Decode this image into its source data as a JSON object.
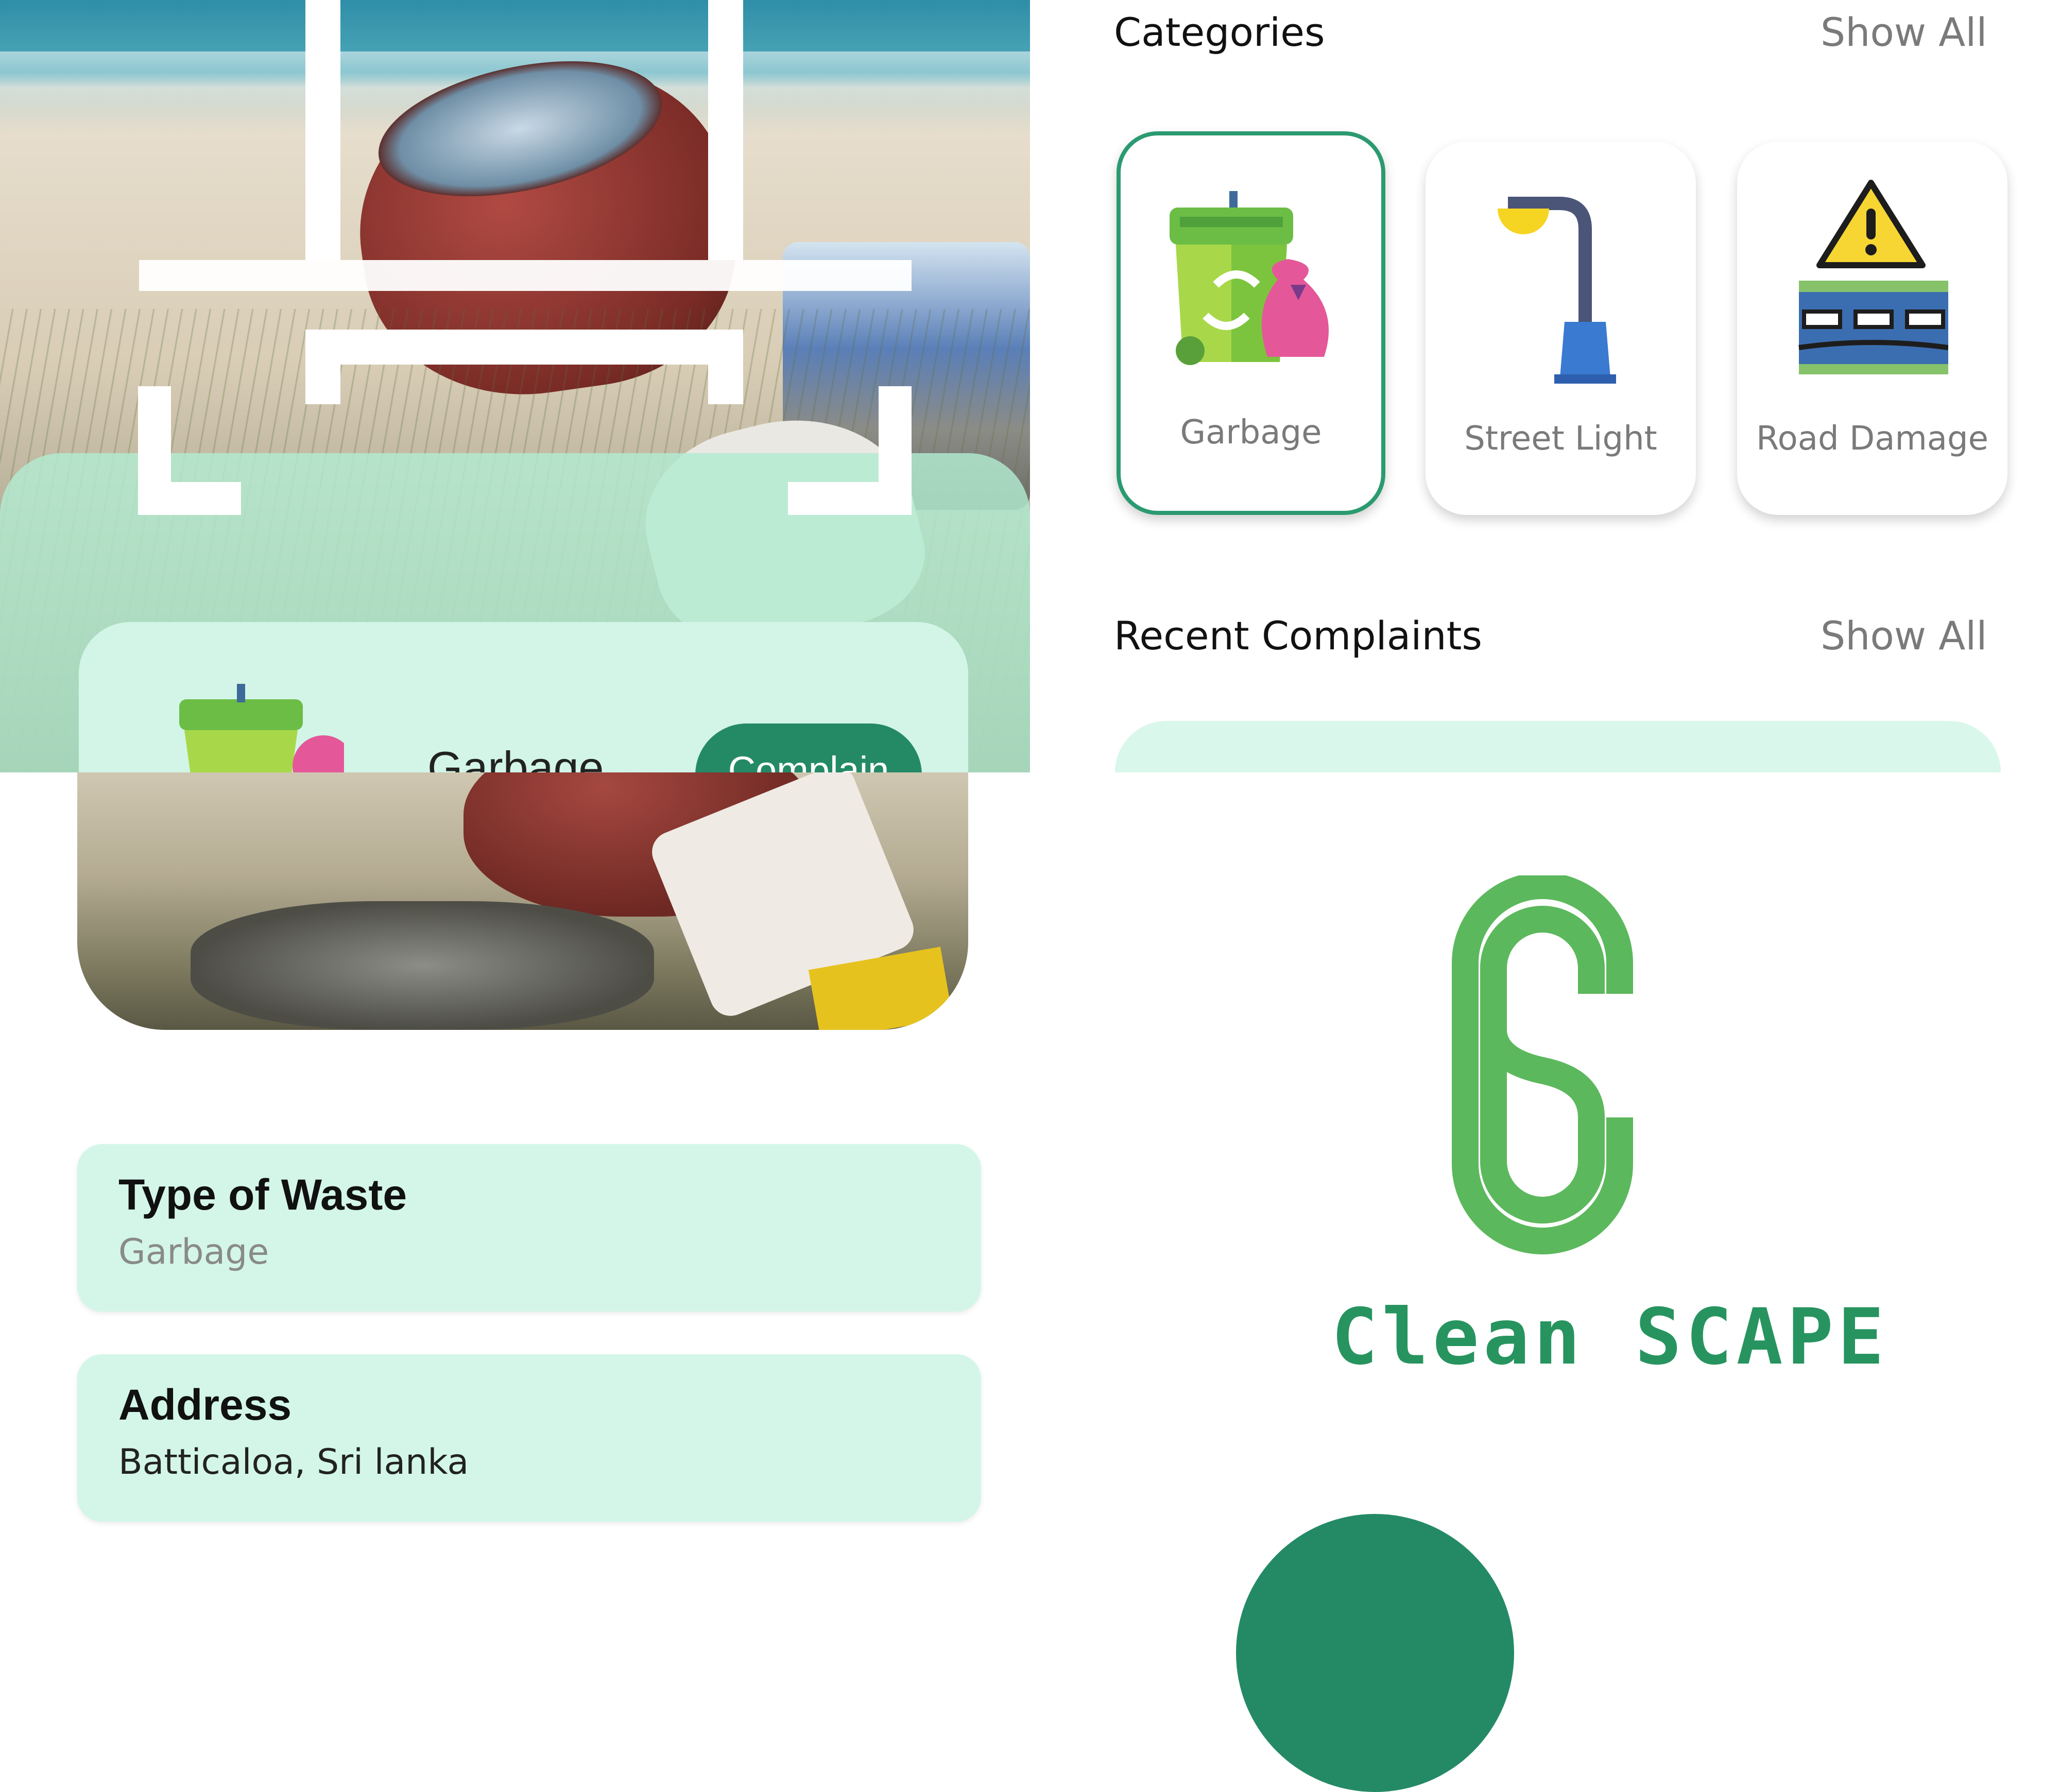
{
  "scan_screen": {
    "result": {
      "category_label": "Garbage",
      "complain_label": "Complain"
    }
  },
  "details_screen": {
    "fields": [
      {
        "label": "Type of Waste",
        "value": "Garbage"
      },
      {
        "label": "Address",
        "value": "Batticaloa, Sri lanka"
      }
    ]
  },
  "home_screen": {
    "categories_title": "Categories",
    "categories_show_all": "Show All",
    "categories": [
      {
        "label": "Garbage",
        "icon": "garbage-bin-icon",
        "selected": true
      },
      {
        "label": "Street Light",
        "icon": "street-light-icon",
        "selected": false
      },
      {
        "label": "Road Damage",
        "icon": "road-damage-icon",
        "selected": false
      }
    ],
    "recent_title": "Recent Complaints",
    "recent_show_all": "Show All"
  },
  "splash_screen": {
    "brand_name": "Clean SCAPE",
    "logo_icon": "cleanscape-logo-icon"
  },
  "colors": {
    "primary": "#248a66",
    "mint": "#d3f6e8",
    "logo_green": "#5cb85c"
  }
}
